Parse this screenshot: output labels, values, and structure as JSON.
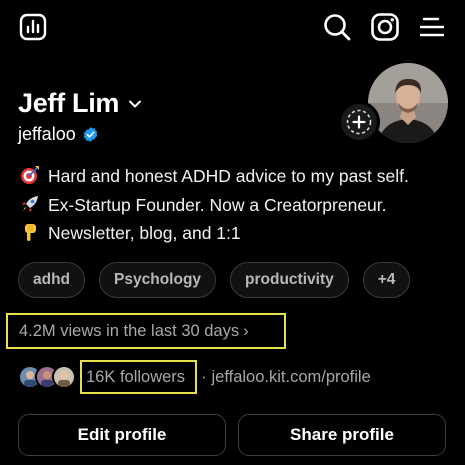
{
  "header": {
    "icons": [
      "insights-icon",
      "search-icon",
      "instagram-icon",
      "menu-icon"
    ]
  },
  "profile": {
    "name": "Jeff Lim",
    "handle": "jeffaloo",
    "verified": true,
    "bio": [
      {
        "icon": "target-icon",
        "text": "Hard and honest ADHD advice to my past self."
      },
      {
        "icon": "rocket-icon",
        "text": "Ex-Startup Founder. Now a Creatorpreneur."
      },
      {
        "icon": "pointing-down-icon",
        "text": "Newsletter, blog, and 1:1"
      }
    ],
    "tags": [
      "adhd",
      "Psychology",
      "productivity",
      "+4"
    ],
    "views": "4.2M views in the last 30 days",
    "views_arrow": "›",
    "followers": "16K followers",
    "link_separator": "·",
    "link": "jeffaloo.kit.com/profile"
  },
  "actions": {
    "edit": "Edit profile",
    "share": "Share profile"
  },
  "colors": {
    "background": "#000000",
    "text": "#f5f5f5",
    "muted": "#a8a8a8",
    "highlight_outline": "#e8e04a",
    "verified": "#1d9bf0"
  }
}
